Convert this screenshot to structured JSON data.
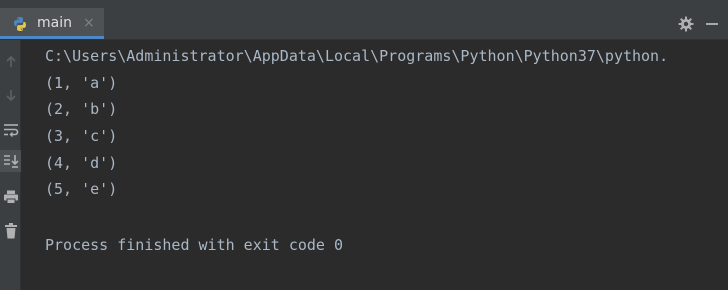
{
  "tab": {
    "label": "main",
    "close": "×"
  },
  "console": {
    "command_line": "C:\\Users\\Administrator\\AppData\\Local\\Programs\\Python\\Python37\\python.",
    "output_lines": [
      "(1, 'a')",
      "(2, 'b')",
      "(3, 'c')",
      "(4, 'd')",
      "(5, 'e')"
    ],
    "exit_message": "Process finished with exit code 0"
  },
  "icons": {
    "tab": "python-icon",
    "settings": "gear-icon",
    "hide": "minimize-icon",
    "toolbar": [
      "arrow-up-icon",
      "arrow-down-icon",
      "soft-wrap-icon",
      "scroll-to-end-icon",
      "print-icon",
      "trash-icon"
    ]
  },
  "colors": {
    "background": "#2b2b2b",
    "panel": "#3c3f41",
    "text": "#a9b7c6",
    "accent": "#4a88c7"
  }
}
